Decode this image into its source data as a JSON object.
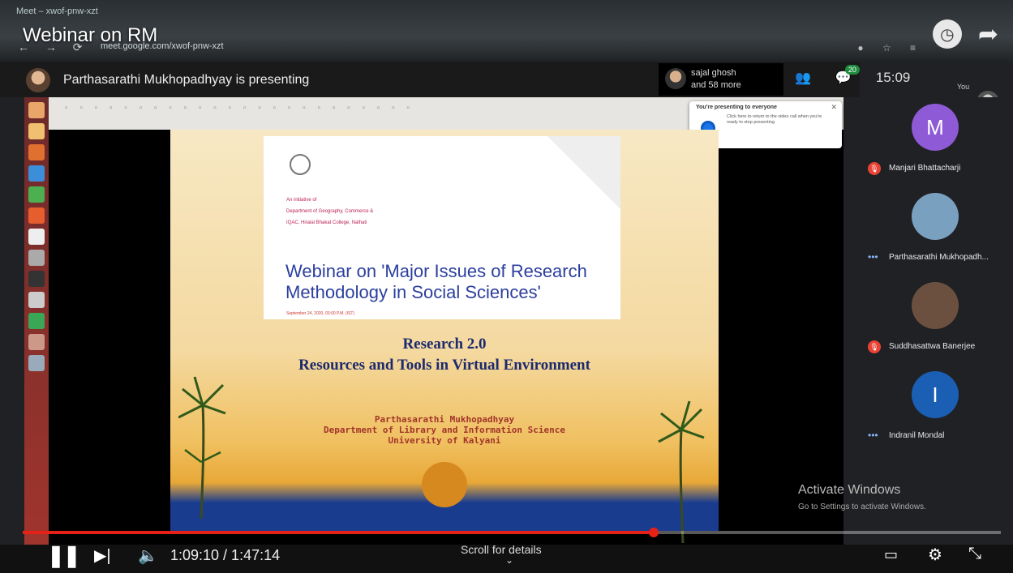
{
  "browser": {
    "tab_label": "Meet – xwof-pnw-xzt",
    "url": "meet.google.com/xwof-pnw-xzt"
  },
  "video": {
    "title": "Webinar on RM"
  },
  "meet": {
    "presenter_text": "Parthasarathi Mukhopadhyay is presenting",
    "viewer_name": "sajal ghosh",
    "viewer_more": "and 58 more",
    "clock": "15:09",
    "chat_badge": "20",
    "you_label": "You",
    "sharing_title": "You're presenting to everyone",
    "sharing_body": "Click here to return to the video call when you're ready to stop presenting"
  },
  "slide": {
    "header_inst_1": "An initiative of",
    "header_inst_2": "Department of Geography, Commerce &",
    "header_inst_3": "IQAC, Hiralal Bhakat College, Nalhati",
    "header_title": "Webinar on 'Major Issues of Research Methodology in Social Sciences'",
    "header_date": "September 24, 2020, 03:00 P.M. (IST)",
    "title_1": "Research 2.0",
    "title_2": "Resources and Tools in Virtual Environment",
    "presenter_1": "Parthasarathi Mukhopadhyay",
    "presenter_2": "Department of Library and Information Science",
    "presenter_3": "University of Kalyani"
  },
  "participants": [
    {
      "initial": "M",
      "name": "Manjari Bhattacharji",
      "color": "#8e5ad6",
      "status": "muted"
    },
    {
      "initial": "",
      "name": "Parthasarathi Mukhopadh...",
      "color": "#7aa0c0",
      "status": "more"
    },
    {
      "initial": "",
      "name": "Suddhasattwa Banerjee",
      "color": "#6b5040",
      "status": "muted"
    },
    {
      "initial": "I",
      "name": "Indranil Mondal",
      "color": "#1a5fb4",
      "status": "more"
    }
  ],
  "windows": {
    "activate_title": "Activate Windows",
    "activate_sub": "Go to Settings to activate Windows."
  },
  "player": {
    "time": "1:09:10 / 1:47:14",
    "progress": 0.645,
    "scroll_hint": "Scroll for details",
    "accent": "#e62117"
  }
}
